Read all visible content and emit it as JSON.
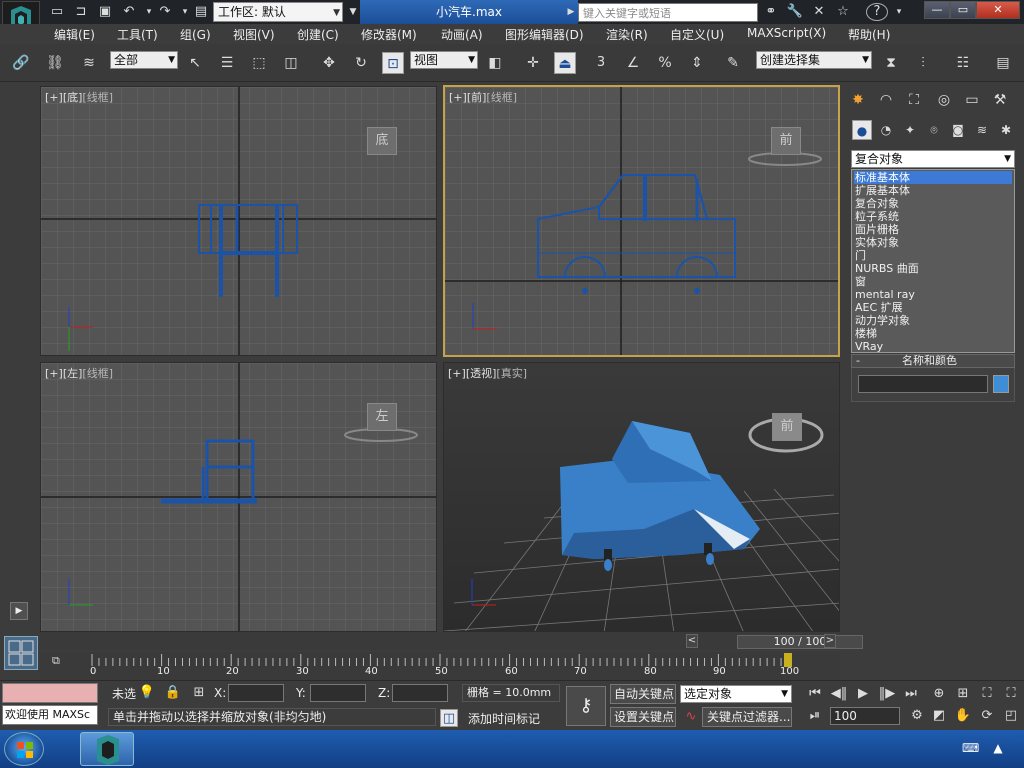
{
  "title_bar": {
    "workspace_label": "工作区: 默认",
    "document_title": "小汽车.max",
    "search_placeholder": "键入关键字或短语",
    "help_icon": "?"
  },
  "menu": {
    "items": [
      "编辑(E)",
      "工具(T)",
      "组(G)",
      "视图(V)",
      "创建(C)",
      "修改器(M)",
      "动画(A)",
      "图形编辑器(D)",
      "渲染(R)",
      "自定义(U)",
      "MAXScript(X)",
      "帮助(H)"
    ]
  },
  "toolbar": {
    "selection_filter": "全部",
    "coord_system": "视图",
    "named_selection": "创建选择集",
    "snap_value": "3"
  },
  "viewports": {
    "top_left": {
      "label_plus": "[+]",
      "label_view": "[底]",
      "label_mode": "[线框]",
      "cube_text": "底"
    },
    "top_right": {
      "label_plus": "[+]",
      "label_view": "[前]",
      "label_mode": "[线框]",
      "cube_text": "前"
    },
    "bottom_left": {
      "label_plus": "[+]",
      "label_view": "[左]",
      "label_mode": "[线框]",
      "cube_text": "左"
    },
    "bottom_right": {
      "label_plus": "[+]",
      "label_view": "[透视]",
      "label_mode": "[真实]",
      "cube_text": "前"
    }
  },
  "command_panel": {
    "category_selected": "复合对象",
    "options": [
      "标准基本体",
      "扩展基本体",
      "复合对象",
      "粒子系统",
      "面片栅格",
      "实体对象",
      "门",
      "NURBS 曲面",
      "窗",
      "mental ray",
      "AEC 扩展",
      "动力学对象",
      "楼梯",
      "VRay"
    ],
    "highlighted_index": 0,
    "rollout_title": "名称和颜色",
    "object_color": "#3d8ed6"
  },
  "timeline": {
    "frame_label": "100 / 100",
    "ticks": [
      "0",
      "10",
      "20",
      "30",
      "40",
      "50",
      "60",
      "70",
      "80",
      "90",
      "100"
    ],
    "current_frame": 100,
    "total_frames": 100
  },
  "status": {
    "maxscript_listener": "欢迎使用 MAXSc",
    "selection_text": "未选",
    "x_label": "X:",
    "y_label": "Y:",
    "z_label": "Z:",
    "grid_text": "栅格 = 10.0mm",
    "auto_key": "自动关键点",
    "set_key": "设置关键点",
    "key_mode_select": "选定对象",
    "key_filter": "关键点过滤器...",
    "prompt": "单击并拖动以选择并缩放对象(非均匀地)",
    "add_time_tag": "添加时间标记",
    "frame_field": "100"
  },
  "colors": {
    "accent_blue": "#1c4e98",
    "active_border": "#c8a24a",
    "wire_blue": "#1a53a8",
    "model_blue": "#3a80c8"
  }
}
